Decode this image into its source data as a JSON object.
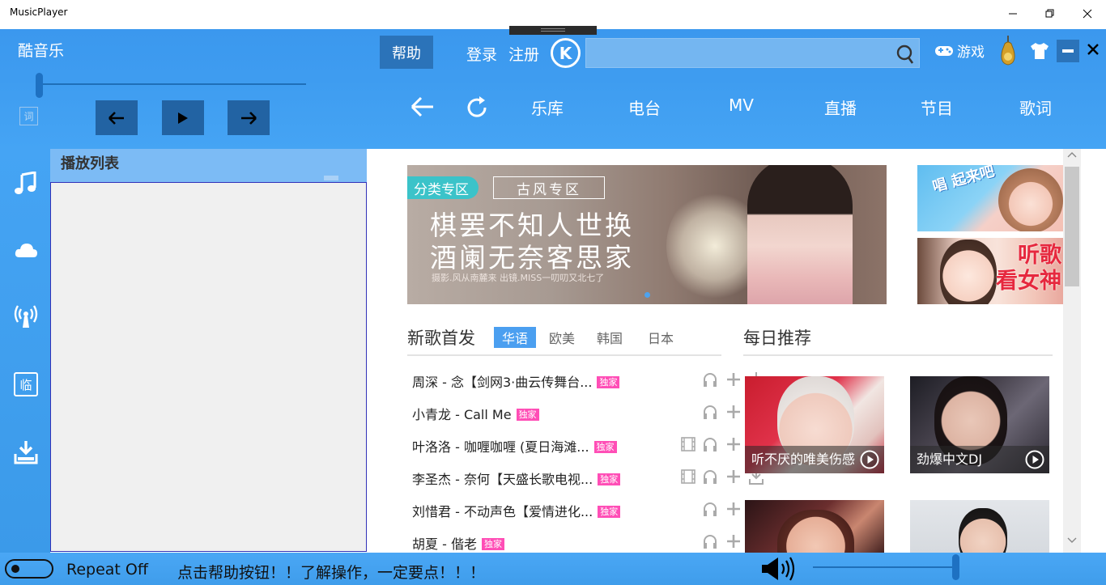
{
  "window": {
    "title": "MusicPlayer"
  },
  "header": {
    "app_name": "酷音乐",
    "help_label": "帮助",
    "login_label": "登录",
    "register_label": "注册",
    "k_logo": "K",
    "search": {
      "value": "",
      "placeholder": ""
    },
    "game_label": "游戏",
    "lyric_icon_text": "词",
    "progress_fraction": 0.0,
    "nav_items": [
      "乐库",
      "电台",
      "MV",
      "直播",
      "节目",
      "歌词"
    ]
  },
  "sidebar": {
    "icons": [
      "music-note-icon",
      "cloud-icon",
      "radio-antenna-icon",
      "temp-list-icon",
      "download-icon"
    ],
    "temp_icon_text": "临"
  },
  "playlist": {
    "title": "播放列表"
  },
  "banner": {
    "tag": "分类专区",
    "subtag": "古风专区",
    "line1": "棋罢不知人世换",
    "line2": "酒阑无奈客思家",
    "credit": "摄影.风从南麓来  出镜.MISS一叨叨又北七了"
  },
  "promos": {
    "promo1_text": "唱 起来吧",
    "promo2_line1": "听歌",
    "promo2_line2": "看女神"
  },
  "new_songs": {
    "title": "新歌首发",
    "tabs": [
      "华语",
      "欧美",
      "韩国",
      "日本"
    ],
    "active_tab": "华语",
    "exclusive_label": "独家",
    "songs": [
      {
        "title": "周深 - 念【剑网3·曲云传舞台...",
        "mv": false
      },
      {
        "title": "小青龙 - Call Me",
        "mv": false
      },
      {
        "title": "叶洛洛 - 咖喱咖喱 (夏日海滩...",
        "mv": true
      },
      {
        "title": "李圣杰 - 奈何【天盛长歌电视...",
        "mv": true
      },
      {
        "title": "刘惜君 - 不动声色【爱情进化...",
        "mv": false
      },
      {
        "title": "胡夏 - 偕老",
        "mv": false
      }
    ]
  },
  "daily": {
    "title": "每日推荐",
    "cards": [
      {
        "caption": "听不厌的唯美伤感"
      },
      {
        "caption": "劲爆中文DJ"
      },
      {
        "caption": ""
      },
      {
        "caption": ""
      }
    ]
  },
  "status": {
    "repeat_label": "Repeat Off",
    "hint": "点击帮助按钮！！了解操作，一定要点！！！",
    "volume_fraction": 1.0
  },
  "colors": {
    "header_blue": "#3e9cf0",
    "dark_button": "#2263a3",
    "tab_active": "#4b9ff0",
    "exclusive_pink": "#ff4eb6"
  }
}
